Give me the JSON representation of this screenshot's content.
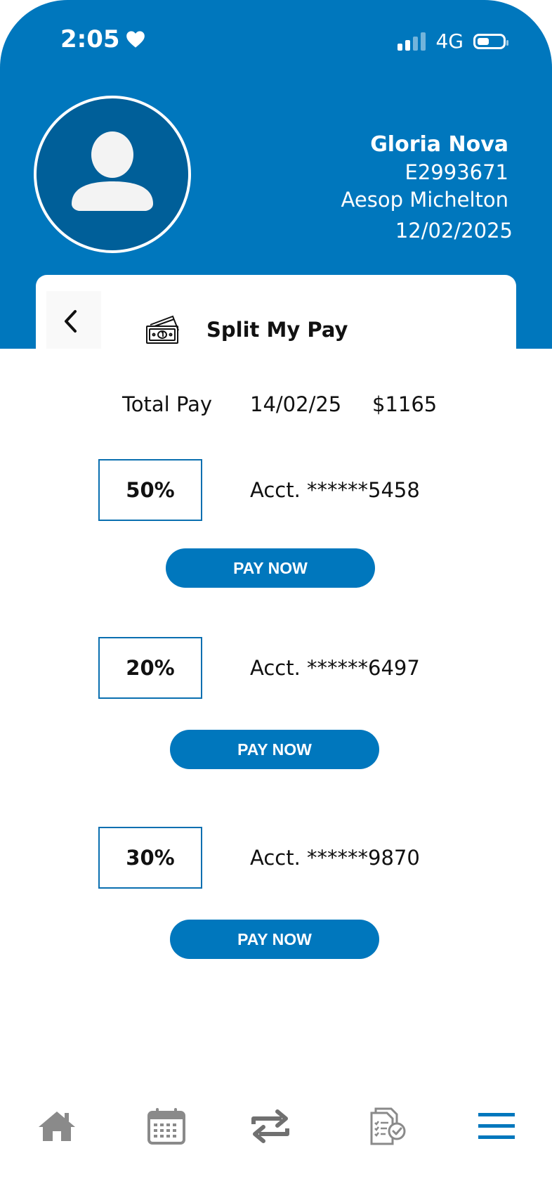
{
  "status_bar": {
    "time": "2:05",
    "network": "4G"
  },
  "user": {
    "name": "Gloria Nova",
    "id": "E2993671",
    "company": "Aesop Michelton",
    "date": "12/02/2025"
  },
  "card": {
    "title": "Split My Pay"
  },
  "total": {
    "label": "Total Pay",
    "date": "14/02/25",
    "amount": "$1165"
  },
  "splits": [
    {
      "percent": "50%",
      "account": "Acct. ******5458",
      "button": "PAY NOW"
    },
    {
      "percent": "20%",
      "account": "Acct. ******6497",
      "button": "PAY NOW"
    },
    {
      "percent": "30%",
      "account": "Acct. ******9870",
      "button": "PAY NOW"
    }
  ],
  "icons": {
    "status": "heart-icon",
    "back": "chevron-left-icon",
    "card": "money-icon",
    "nav": [
      "home-icon",
      "calendar-icon",
      "transfer-icon",
      "documents-check-icon",
      "menu-icon"
    ]
  },
  "colors": {
    "primary": "#0077bd",
    "avatar_bg": "#005f99",
    "nav_gray": "#8a8a8a"
  }
}
